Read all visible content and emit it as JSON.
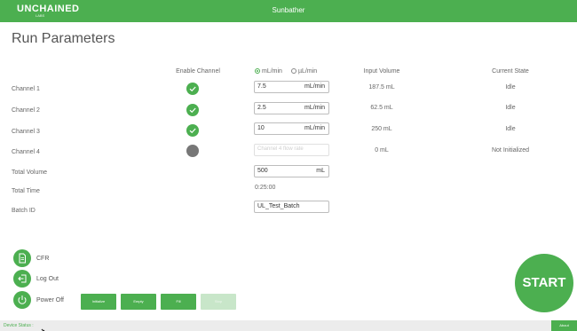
{
  "header": {
    "logo": "UNCHAINED",
    "logo_sub": "LABS",
    "app_name": "Sunbather",
    "brand_color": "#4caf50"
  },
  "page_title": "Run Parameters",
  "columns": {
    "enable": "Enable Channel",
    "unit_ml": "mL/min",
    "unit_ul": "µL/min",
    "input_volume": "Input Volume",
    "current_state": "Current State",
    "selected_unit": "mL/min"
  },
  "channels": [
    {
      "label": "Channel 1",
      "enabled": true,
      "rate": "7.5",
      "unit": "mL/min",
      "input_volume": "187.5 mL",
      "state": "Idle"
    },
    {
      "label": "Channel 2",
      "enabled": true,
      "rate": "2.5",
      "unit": "mL/min",
      "input_volume": "62.5 mL",
      "state": "Idle"
    },
    {
      "label": "Channel 3",
      "enabled": true,
      "rate": "10",
      "unit": "mL/min",
      "input_volume": "250 mL",
      "state": "Idle"
    },
    {
      "label": "Channel 4",
      "enabled": false,
      "placeholder": "Channel 4 flow rate",
      "input_volume": "0 mL",
      "state": "Not Initialized"
    }
  ],
  "total_volume": {
    "label": "Total Volume",
    "value": "500",
    "unit": "mL"
  },
  "total_time": {
    "label": "Total Time",
    "value": "0:25:00"
  },
  "batch_id": {
    "label": "Batch ID",
    "value": "UL_Test_Batch"
  },
  "sidebar": {
    "cfr": "CFR",
    "logout": "Log Out",
    "power": "Power Off"
  },
  "actions": {
    "initialize": "Initialize",
    "empty": "Empty",
    "fill": "Fill",
    "stop": "Stop"
  },
  "start": "START",
  "footer": {
    "device_status": "Device Status :",
    "about": "About"
  }
}
